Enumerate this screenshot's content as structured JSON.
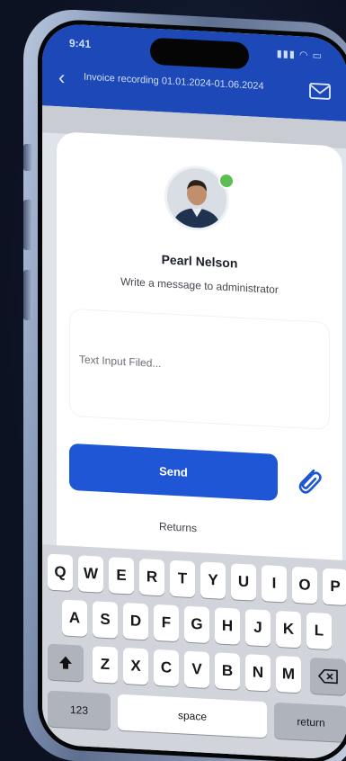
{
  "status_bar": {
    "time": "9:41",
    "icons": "▮▮▮ ◠ ▭"
  },
  "header": {
    "back_icon": "chevron-left-icon",
    "title": "Invoice recording 01.01.2024-01.06.2024",
    "mail_icon": "mail-icon"
  },
  "card": {
    "user_name": "Pearl Nelson",
    "prompt": "Write a message to administrator",
    "input_placeholder": "Text Input Filed...",
    "send_label": "Send",
    "attach_icon": "paperclip-icon",
    "returns_label": "Returns"
  },
  "keyboard": {
    "row1": [
      "Q",
      "W",
      "E",
      "R",
      "T",
      "Y",
      "U",
      "I",
      "O",
      "P"
    ],
    "row2": [
      "A",
      "S",
      "D",
      "F",
      "G",
      "H",
      "J",
      "K",
      "L"
    ],
    "row3": [
      "Z",
      "X",
      "C",
      "V",
      "B",
      "N",
      "M"
    ],
    "shift_icon": "shift-icon",
    "delete_icon": "backspace-icon",
    "numbers_label": "123",
    "space_label": "space",
    "return_label": "return"
  },
  "colors": {
    "accent": "#1f56d6",
    "header": "#1d49b8",
    "online": "#5cbf52"
  }
}
